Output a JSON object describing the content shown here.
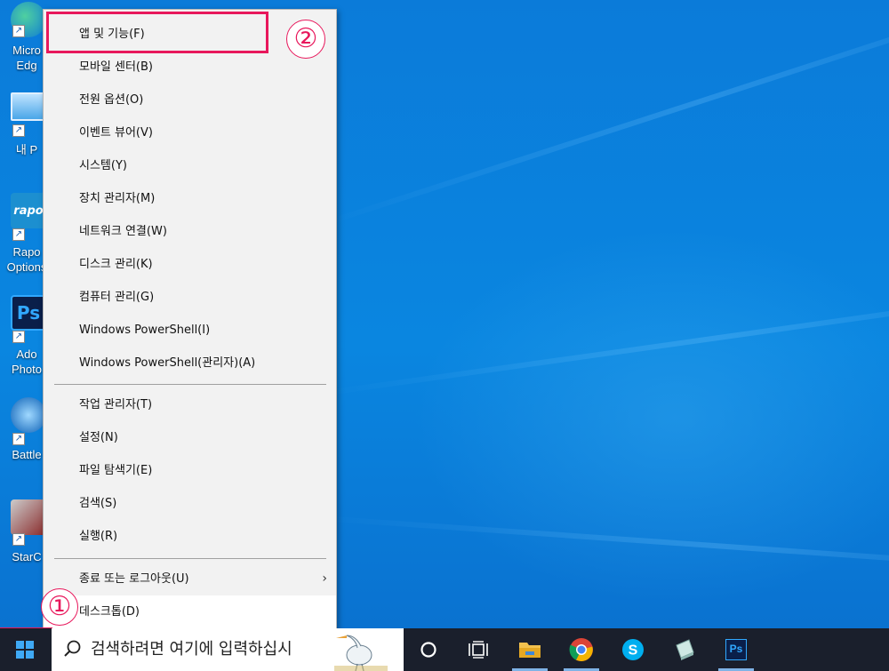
{
  "desktop": {
    "icons": [
      {
        "label": "Micro\nEdg",
        "icon": "edge-icon"
      },
      {
        "label": "내 P",
        "icon": "this-pc-icon"
      },
      {
        "label": "Rapo\nOptions",
        "icon": "rapoo-options-icon"
      },
      {
        "label": "Ado\nPhoto",
        "icon": "photoshop-icon"
      },
      {
        "label": "Battle",
        "icon": "battlenet-icon"
      },
      {
        "label": "StarC",
        "icon": "starcraft-icon"
      }
    ],
    "rapoo_glyph": "rapo",
    "ps_glyph": "Ps",
    "shortcut_glyph": "↗"
  },
  "menu": {
    "group1": [
      "앱 및 기능(F)",
      "모바일 센터(B)",
      "전원 옵션(O)",
      "이벤트 뷰어(V)",
      "시스템(Y)",
      "장치 관리자(M)",
      "네트워크 연결(W)",
      "디스크 관리(K)",
      "컴퓨터 관리(G)",
      "Windows PowerShell(I)",
      "Windows PowerShell(관리자)(A)"
    ],
    "group2": [
      "작업 관리자(T)",
      "설정(N)",
      "파일 탐색기(E)",
      "검색(S)",
      "실행(R)"
    ],
    "group3": [
      "종료 또는 로그아웃(U)",
      "데스크톱(D)"
    ],
    "submenu_arrow": "›"
  },
  "annotations": {
    "step1": "①",
    "step2": "②",
    "color": "#e8185c"
  },
  "taskbar": {
    "search_placeholder": "검색하려면 여기에 입력하십시",
    "apps": [
      "cortana-icon",
      "task-view-icon",
      "file-explorer-icon",
      "chrome-icon",
      "skype-icon",
      "notepad-icon",
      "photoshop-icon"
    ],
    "ps_label": "Ps"
  }
}
